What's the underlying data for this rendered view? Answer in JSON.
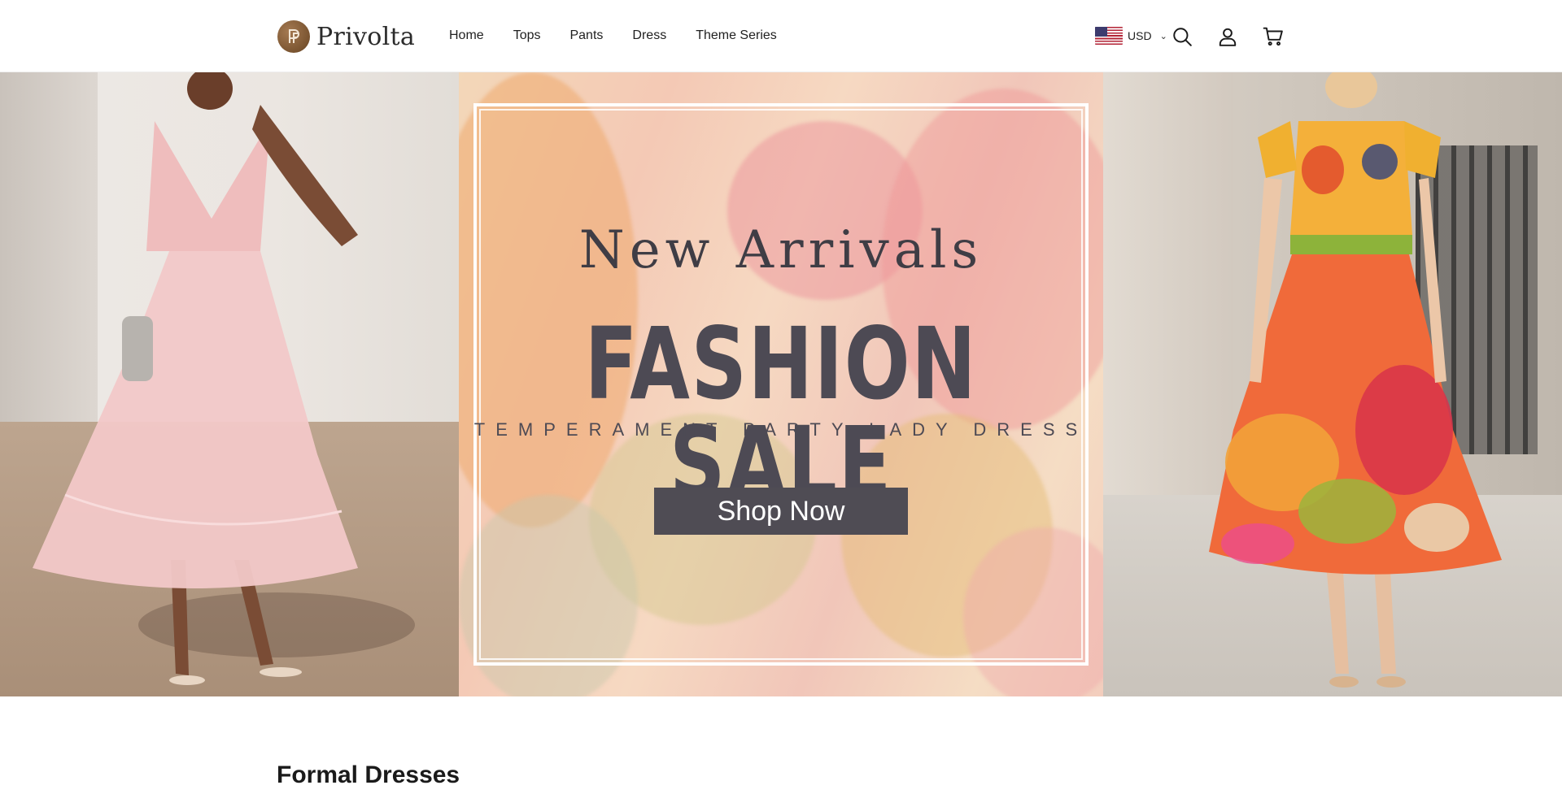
{
  "header": {
    "brand": "Privolta",
    "nav": [
      "Home",
      "Tops",
      "Pants",
      "Dress",
      "Theme Series"
    ],
    "currency": "USD"
  },
  "hero": {
    "eyebrow": "New Arrivals",
    "headline": "FASHION SALE",
    "subline": "TEMPERAMENT PARTY LADY DRESS",
    "cta": "Shop Now"
  },
  "section": {
    "title": "Formal Dresses"
  },
  "icons": {
    "search": "search-icon",
    "account": "user-icon",
    "cart": "cart-icon",
    "currency_toggle": "chevron-down-icon",
    "flag": "us-flag-icon"
  }
}
